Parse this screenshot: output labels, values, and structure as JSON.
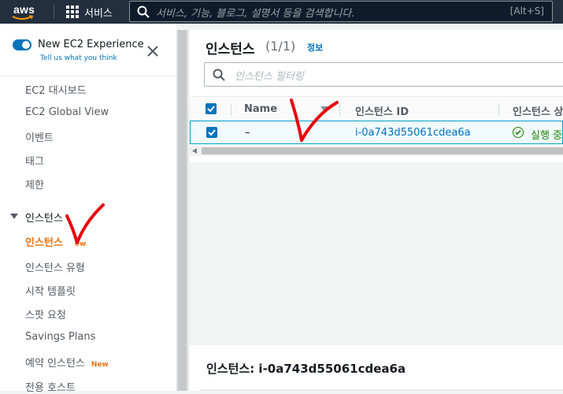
{
  "topbar": {
    "logo_text": "aws",
    "services_label": "서비스",
    "search_placeholder": "서비스, 기능, 블로그, 설명서 등을 검색합니다.",
    "search_shortcut": "[Alt+S]"
  },
  "sidebar": {
    "experience_title": "New EC2 Experience",
    "experience_link": "Tell us what you think",
    "items": [
      {
        "label": "EC2 대시보드"
      },
      {
        "label": "EC2 Global View"
      },
      {
        "label": "이벤트"
      },
      {
        "label": "태그"
      },
      {
        "label": "제한"
      }
    ],
    "section_title": "인스턴스",
    "section_items": [
      {
        "label": "인스턴스",
        "badge": "New",
        "active": true
      },
      {
        "label": "인스턴스 유형"
      },
      {
        "label": "시작 템플릿"
      },
      {
        "label": "스팟 요청"
      },
      {
        "label": "Savings Plans"
      },
      {
        "label": "예약 인스턴스",
        "badge": "New"
      },
      {
        "label": "전용 호스트"
      }
    ],
    "new_badge": "New",
    "new_badge_partial": "ew"
  },
  "main": {
    "title": "인스턴스",
    "count": "(1/1)",
    "info_link": "정보",
    "filter_placeholder": "인스턴스 필터링",
    "columns": [
      "Name",
      "인스턴스 ID",
      "인스턴스 상"
    ],
    "rows": [
      {
        "name": "–",
        "instance_id": "i-0a743d55061cdea6a",
        "state": "실행 중",
        "selected": true
      }
    ],
    "details_title": "인스턴스: i-0a743d55061cdea6a"
  },
  "colors": {
    "topbar": "#232f3e",
    "accent_orange": "#ec7211",
    "link_blue": "#0073bb",
    "running_green": "#1d8102",
    "annotation_red": "#e8000b"
  }
}
